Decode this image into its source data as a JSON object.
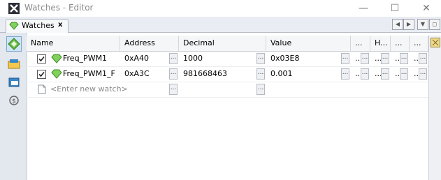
{
  "window": {
    "title": "Watches - Editor",
    "minimize": "—",
    "maximize": "☐",
    "close": "✕"
  },
  "tab": {
    "label": "Watches",
    "close": "x"
  },
  "tabstrip": {
    "prev": "◀",
    "next": "▶",
    "menu": "▼",
    "restore": "◻"
  },
  "sidebar": {
    "icons": [
      "watch-diamond-icon",
      "folder-view-icon",
      "mirror-view-icon",
      "dollar-icon"
    ]
  },
  "columns": [
    "Name",
    "Address",
    "Decimal",
    "Value",
    "...",
    "H...",
    "...",
    "..."
  ],
  "rows": [
    {
      "checked": true,
      "name": "Freq_PWM1",
      "address": "0xA40",
      "decimal": "1000",
      "value": "0x03E8"
    },
    {
      "checked": true,
      "name": "Freq_PWM1_F",
      "address": "0xA3C",
      "decimal": "981668463",
      "value": "0.001"
    }
  ],
  "new_watch_placeholder": "<Enter new watch>",
  "ellipsis": "...",
  "colors": {
    "accent_green": "#5fbf3a",
    "selection_blue": "#cfe5f6",
    "header_bg": "#f5f6f8"
  }
}
